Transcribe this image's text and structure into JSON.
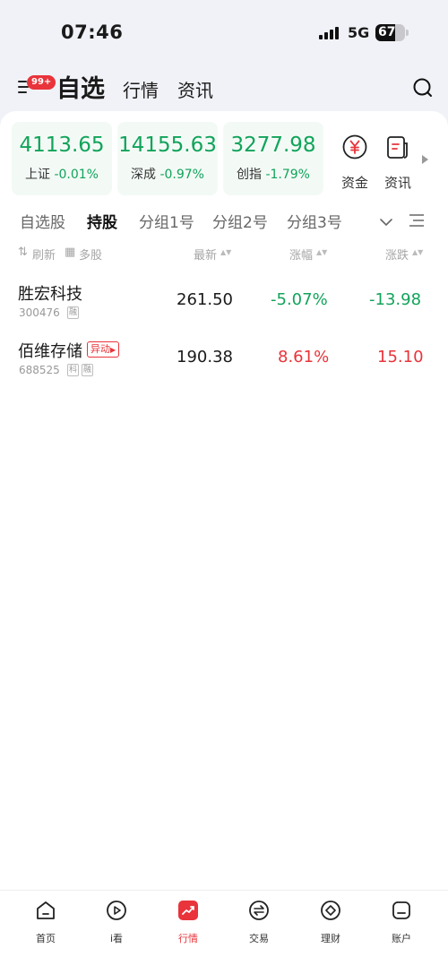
{
  "status_bar": {
    "time": "07:46",
    "network": "5G",
    "battery": "67",
    "battery_level": 0.67
  },
  "header": {
    "badge": "99+",
    "tabs": [
      "自选",
      "行情",
      "资讯"
    ]
  },
  "indices": [
    {
      "value": "4113.65",
      "name": "上证",
      "change": "-0.01%"
    },
    {
      "value": "14155.63",
      "name": "深成",
      "change": "-0.97%"
    },
    {
      "value": "3277.98",
      "name": "创指",
      "change": "-1.79%"
    }
  ],
  "shortcuts": [
    {
      "label": "资金",
      "icon": "yuan-circle-icon"
    },
    {
      "label": "资讯",
      "icon": "news-icon"
    }
  ],
  "group_tabs": [
    "自选股",
    "持股",
    "分组1号",
    "分组2号",
    "分组3号"
  ],
  "columns": {
    "refresh": "刷新",
    "multi": "多股",
    "latest": "最新",
    "pct": "涨幅",
    "change": "涨跌"
  },
  "stocks": [
    {
      "name": "胜宏科技",
      "code": "300476",
      "tags": [
        "融"
      ],
      "price": "261.50",
      "pct": "-5.07%",
      "change": "-13.98"
    },
    {
      "name": "佰维存储",
      "code": "688525",
      "tags": [
        "科",
        "融"
      ],
      "abnormal": "异动",
      "price": "190.38",
      "pct": "8.61%",
      "change": "15.10"
    }
  ],
  "bottom_nav": [
    {
      "label": "首页",
      "icon": "home-icon"
    },
    {
      "label": "i看",
      "icon": "play-icon"
    },
    {
      "label": "行情",
      "icon": "market-icon"
    },
    {
      "label": "交易",
      "icon": "trade-icon"
    },
    {
      "label": "理财",
      "icon": "wealth-icon"
    },
    {
      "label": "账户",
      "icon": "account-icon"
    }
  ],
  "colors": {
    "up": "#e8343a",
    "down": "#12a35a",
    "accent": "#e8343a"
  }
}
